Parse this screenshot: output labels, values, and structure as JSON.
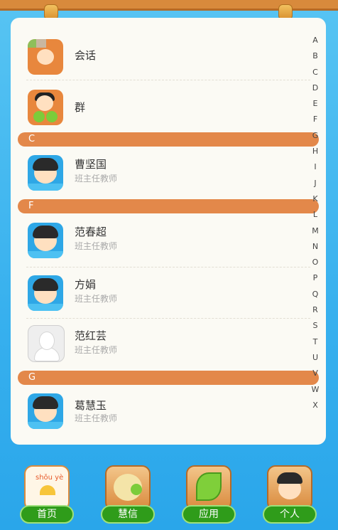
{
  "contacts": [
    {
      "name": "会话",
      "role": "",
      "avatar": "chat-icon"
    },
    {
      "name": "群",
      "role": "",
      "avatar": "group-icon"
    }
  ],
  "sections": [
    {
      "letter": "C",
      "items": [
        {
          "name": "曹坚国",
          "role": "班主任教师",
          "avatar": "boy"
        }
      ]
    },
    {
      "letter": "F",
      "items": [
        {
          "name": "范春超",
          "role": "班主任教师",
          "avatar": "boy"
        },
        {
          "name": "方娟",
          "role": "班主任教师",
          "avatar": "boy"
        },
        {
          "name": "范红芸",
          "role": "班主任教师",
          "avatar": "default"
        }
      ]
    },
    {
      "letter": "G",
      "items": [
        {
          "name": "葛慧玉",
          "role": "班主任教师",
          "avatar": "boy"
        }
      ]
    }
  ],
  "index_letters": [
    "A",
    "B",
    "C",
    "D",
    "E",
    "F",
    "G",
    "H",
    "I",
    "J",
    "K",
    "L",
    "M",
    "N",
    "O",
    "P",
    "Q",
    "R",
    "S",
    "T",
    "U",
    "V",
    "W",
    "X"
  ],
  "tabs": [
    {
      "label": "首页",
      "icon": "book-icon",
      "icon_text": "shǒu yè"
    },
    {
      "label": "慧信",
      "icon": "chick-icon"
    },
    {
      "label": "应用",
      "icon": "leaf-icon"
    },
    {
      "label": "个人",
      "icon": "person-icon"
    }
  ],
  "colors": {
    "accent": "#e3884a",
    "tab_green": "#2f9c1a",
    "background": "#37b0ee"
  }
}
